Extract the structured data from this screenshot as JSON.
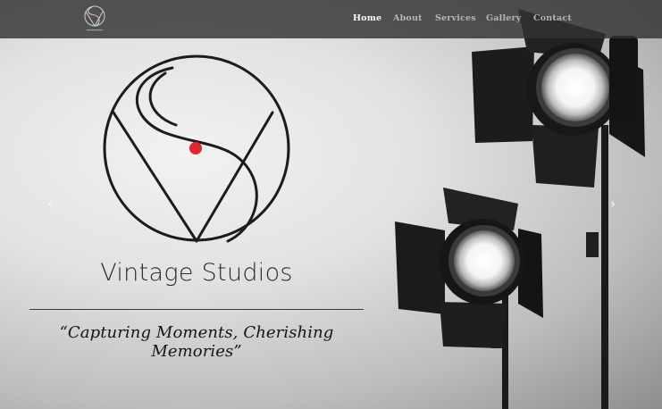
{
  "nav": {
    "links": [
      {
        "label": "Home",
        "active": true
      },
      {
        "label": "About",
        "active": false
      },
      {
        "label": "Services",
        "active": false
      },
      {
        "label": "Gallery",
        "active": false
      },
      {
        "label": "Contact",
        "active": false
      }
    ]
  },
  "hero": {
    "brand_name": "Vintage Studios",
    "tagline": "“Capturing Moments, Cherishing Memories”",
    "prev_arrow": "‹",
    "next_arrow": "›"
  },
  "colors": {
    "accent_dot": "#e0282d",
    "navbar": "#323232",
    "nav_active": "#ffffff",
    "nav_inactive": "#b5b5b5"
  },
  "icons": {
    "logo": "vs-monogram-icon",
    "prev": "chevron-left-icon",
    "next": "chevron-right-icon"
  }
}
